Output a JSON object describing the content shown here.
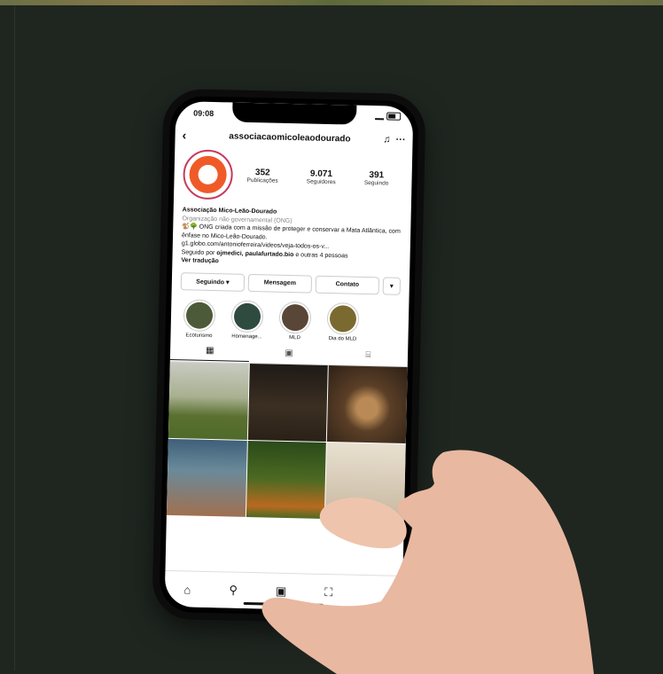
{
  "status": {
    "time": "09:08"
  },
  "header": {
    "back": "‹",
    "username": "associacaomicoleaodourado",
    "bell": "♫",
    "more": "···"
  },
  "profile": {
    "stats": [
      {
        "num": "352",
        "label": "Publicações"
      },
      {
        "num": "9.071",
        "label": "Seguidores"
      },
      {
        "num": "391",
        "label": "Seguindo"
      }
    ]
  },
  "bio": {
    "name": "Associação Mico-Leão-Dourado",
    "category": "Organização não governamental (ONG)",
    "line1": "🐒🌳 ONG criada com a missão de proteger e conservar a Mata Atlântica, com ênfase no Mico-Leão-Dourado.",
    "link": "g1.globo.com/antonioferreira/videos/veja-todos-os-v...",
    "follow_prefix": "Seguido por ",
    "follow_names": "ojmedici, paulafurtado.bio",
    "follow_suffix": " e outras 4 pessoas",
    "translate": "Ver tradução"
  },
  "buttons": {
    "following": "Seguindo ▾",
    "message": "Mensagem",
    "contact": "Contato",
    "more": "▾"
  },
  "highlights": [
    {
      "label": "Ecoturismo",
      "color": "#4d5a3a"
    },
    {
      "label": "Homenage...",
      "color": "#2f4a3e"
    },
    {
      "label": "MLD",
      "color": "#5a4636"
    },
    {
      "label": "Dia do MLD",
      "color": "#7a6a30"
    }
  ],
  "tabs": {
    "grid": "▦",
    "reels": "▣",
    "tagged": "⌸"
  },
  "nav": {
    "home": "⌂",
    "search": "⚲",
    "reels": "▣",
    "shop": "⛶"
  }
}
